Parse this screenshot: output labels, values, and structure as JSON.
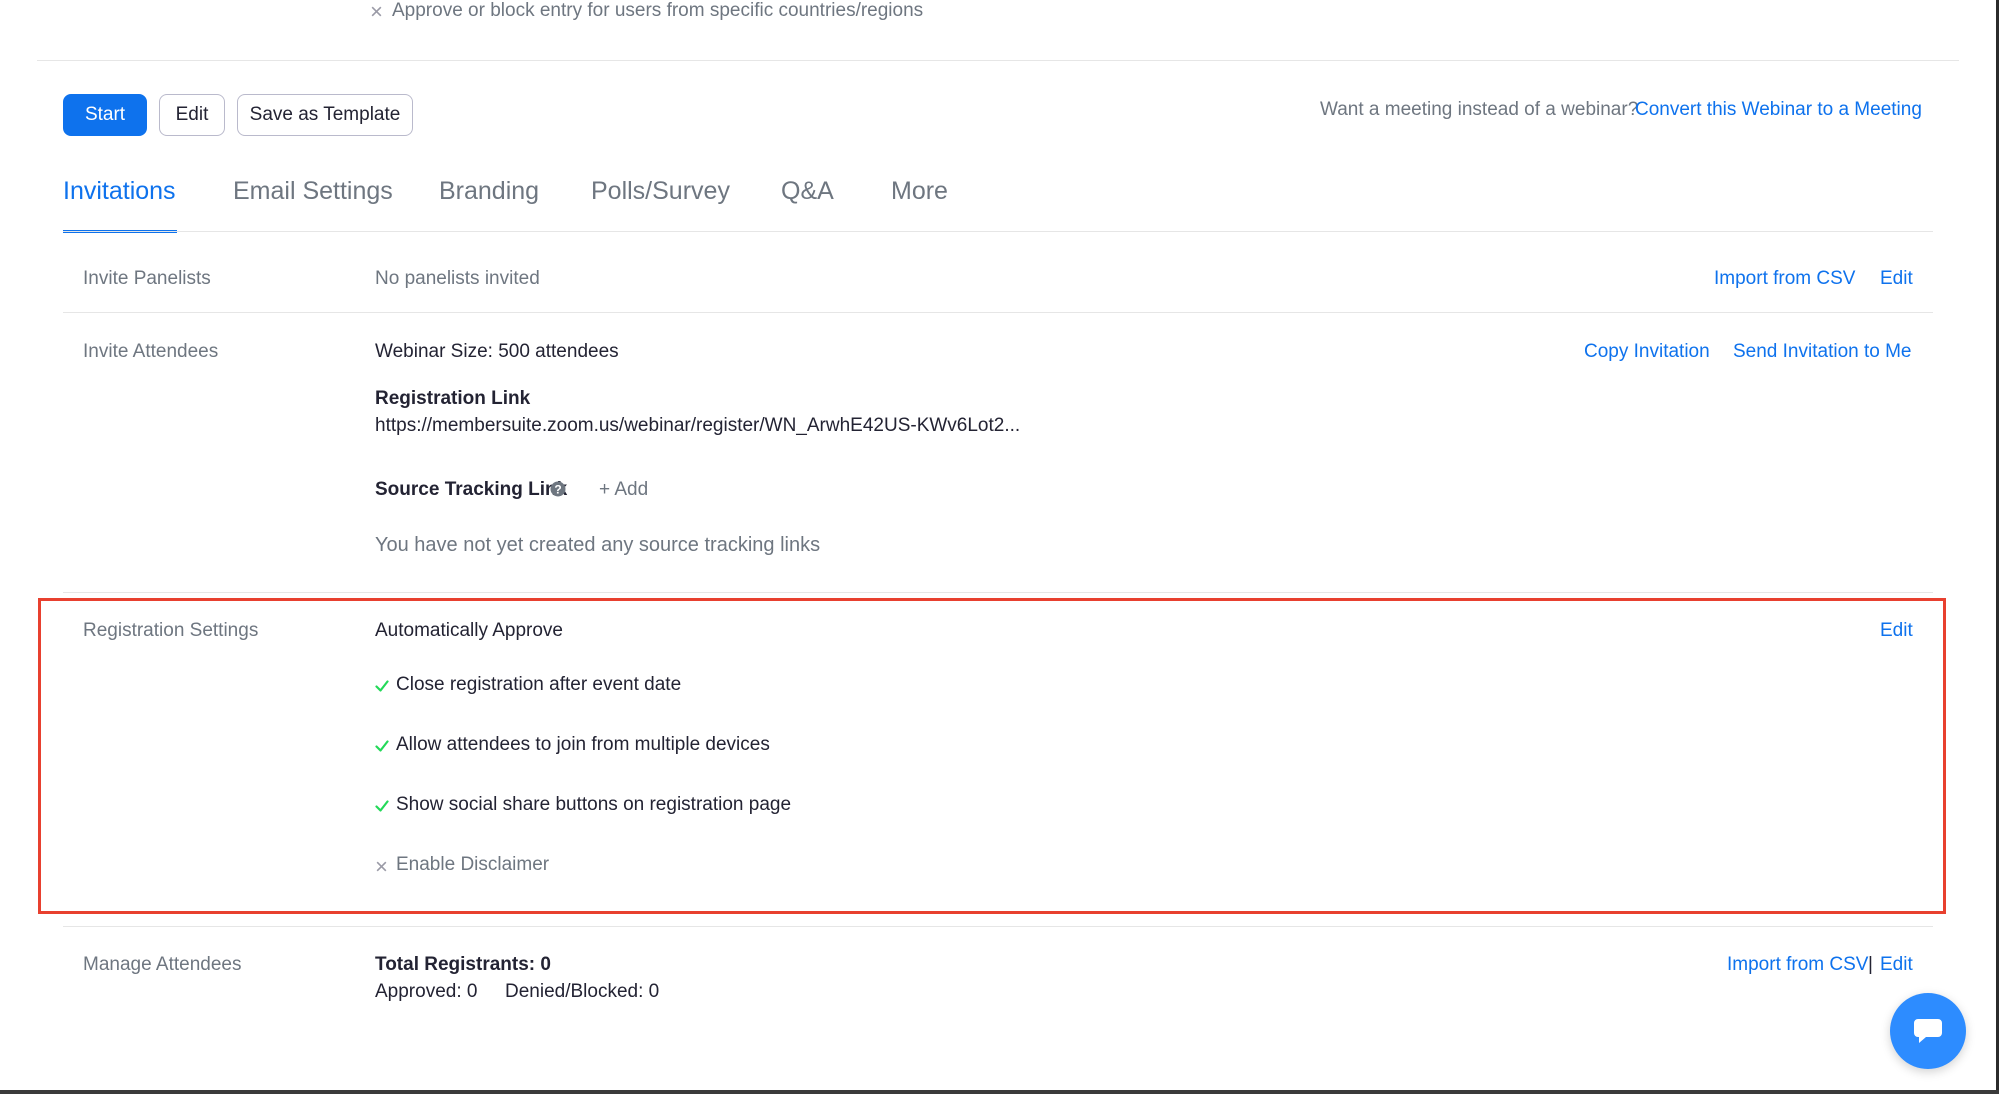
{
  "top_option": {
    "icon": "x-icon",
    "text": "Approve or block entry for users from specific countries/regions"
  },
  "actions": {
    "start": "Start",
    "edit": "Edit",
    "save_template": "Save as Template",
    "convert_prompt": "Want a meeting instead of a webinar?",
    "convert_link": "Convert this Webinar to a Meeting"
  },
  "tabs": [
    {
      "label": "Invitations",
      "active": true
    },
    {
      "label": "Email Settings"
    },
    {
      "label": "Branding"
    },
    {
      "label": "Polls/Survey"
    },
    {
      "label": "Q&A"
    },
    {
      "label": "More"
    }
  ],
  "invite_panelists": {
    "label": "Invite Panelists",
    "value": "No panelists invited",
    "import": "Import from CSV",
    "edit": "Edit"
  },
  "invite_attendees": {
    "label": "Invite Attendees",
    "size": "Webinar Size: 500 attendees",
    "copy": "Copy Invitation",
    "send": "Send Invitation to Me",
    "reg_link_title": "Registration Link",
    "reg_link": "https://membersuite.zoom.us/webinar/register/WN_ArwhE42US-KWv6Lot2...",
    "source_title": "Source Tracking Link",
    "add": "+ Add",
    "source_empty": "You have not yet created any source tracking links"
  },
  "registration_settings": {
    "label": "Registration Settings",
    "approval": "Automatically Approve",
    "edit": "Edit",
    "items": [
      {
        "text": "Close registration after event date",
        "enabled": true,
        "icon": "check-icon"
      },
      {
        "text": "Allow attendees to join from multiple devices",
        "enabled": true,
        "icon": "check-icon"
      },
      {
        "text": "Show social share buttons on registration page",
        "enabled": true,
        "icon": "check-icon"
      },
      {
        "text": "Enable Disclaimer",
        "enabled": false,
        "icon": "x-icon"
      }
    ]
  },
  "manage_attendees": {
    "label": "Manage Attendees",
    "total": "Total Registrants: 0",
    "approved": "Approved: 0",
    "denied": "Denied/Blocked: 0",
    "import": "Import from CSV",
    "separator": "|",
    "edit": "Edit"
  },
  "colors": {
    "accent": "#0e72ed",
    "check": "#23d959",
    "highlight": "#e8402f",
    "chat": "#2d8cff"
  }
}
